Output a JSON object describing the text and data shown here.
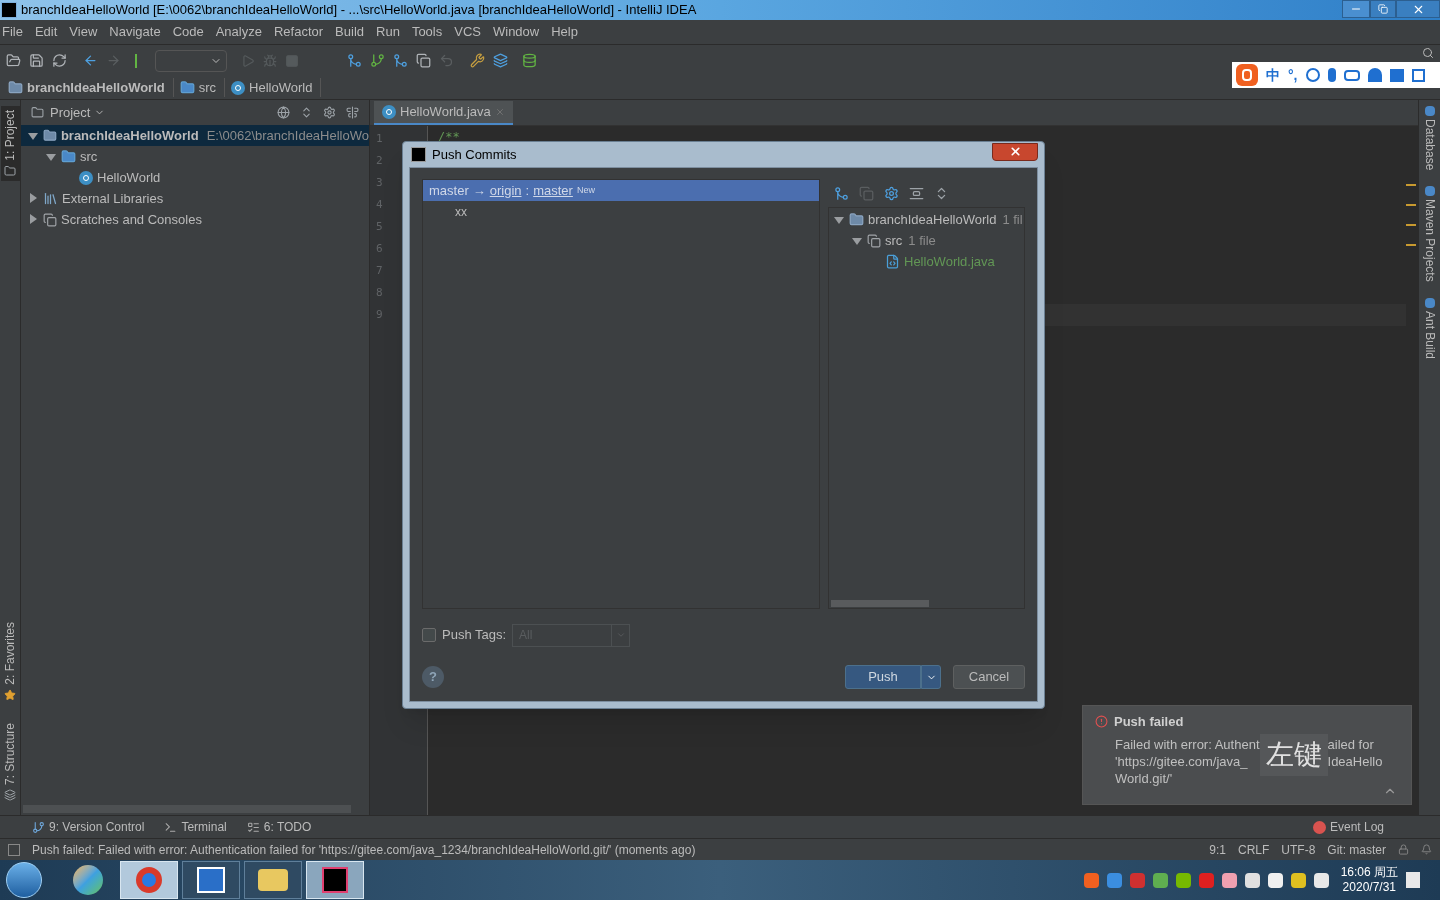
{
  "window": {
    "title": "branchIdeaHelloWorld [E:\\0062\\branchIdeaHelloWorld] - ...\\src\\HelloWorld.java [branchIdeaHelloWorld] - IntelliJ IDEA"
  },
  "menu": [
    "File",
    "Edit",
    "View",
    "Navigate",
    "Code",
    "Analyze",
    "Refactor",
    "Build",
    "Run",
    "Tools",
    "VCS",
    "Window",
    "Help"
  ],
  "ime": {
    "labels": [
      "中",
      "°,"
    ]
  },
  "breadcrumbs": [
    {
      "label": "branchIdeaHelloWorld",
      "kind": "project"
    },
    {
      "label": "src",
      "kind": "folder"
    },
    {
      "label": "HelloWorld",
      "kind": "class"
    }
  ],
  "left_stripe": [
    {
      "label": "1: Project",
      "selected": true,
      "kind": "project"
    },
    {
      "label": "2: Favorites",
      "selected": false,
      "kind": "favorites"
    },
    {
      "label": "7: Structure",
      "selected": false,
      "kind": "structure"
    }
  ],
  "project_panel": {
    "title": "Project",
    "tree": [
      {
        "label": "branchIdeaHelloWorld",
        "detail": "E:\\0062\\branchIdeaHelloWo",
        "kind": "project",
        "expanded": true,
        "selected": true,
        "children": [
          {
            "label": "src",
            "kind": "folder",
            "expanded": true,
            "selected": false,
            "children": [
              {
                "label": "HelloWorld",
                "kind": "class",
                "selected": false
              }
            ]
          }
        ]
      },
      {
        "label": "External Libraries",
        "kind": "libraries",
        "expanded": false,
        "selected": false
      },
      {
        "label": "Scratches and Consoles",
        "kind": "scratches",
        "expanded": false,
        "selected": false
      }
    ]
  },
  "editor": {
    "tabs": [
      {
        "label": "HelloWorld.java",
        "selected": true
      }
    ],
    "line_numbers": [
      "1",
      "2",
      "3",
      "4",
      "5",
      "6",
      "7",
      "8",
      "9"
    ],
    "code_lines": [
      "/**"
    ]
  },
  "right_stripe": [
    "Database",
    "Maven Projects",
    "Ant Build"
  ],
  "dialog": {
    "title": "Push Commits",
    "push_spec": {
      "source": "master",
      "arrow": "→",
      "remote": "origin",
      "separator": ":",
      "target": "master",
      "badge": "New",
      "selected": true
    },
    "commits": [
      "xx"
    ],
    "changes_tree": [
      {
        "label": "branchIdeaHelloWorld",
        "detail": "1 fil",
        "kind": "project",
        "expanded": true,
        "children": [
          {
            "label": "src",
            "detail": "1 file",
            "kind": "folder",
            "expanded": true,
            "children": [
              {
                "label": "HelloWorld.java",
                "kind": "added-file"
              }
            ]
          }
        ]
      }
    ],
    "push_tags": {
      "label": "Push Tags:",
      "checked": false,
      "value": "All",
      "disabled": true
    },
    "help": "?",
    "buttons": [
      {
        "label": "Push",
        "kind": "primary"
      },
      {
        "label": "Cancel",
        "kind": "secondary"
      }
    ]
  },
  "notification": {
    "title": "Push failed",
    "left_lines": [
      "Failed with error: Authent",
      "'https://gitee.com/java_",
      "World.git/'"
    ],
    "right_lines": [
      "ailed for",
      "IdeaHello"
    ],
    "overlay": "左键"
  },
  "tool_windows": [
    {
      "label": "9: Version Control",
      "kind": "vcs"
    },
    {
      "label": "Terminal",
      "kind": "terminal"
    },
    {
      "label": "6: TODO",
      "kind": "todo"
    }
  ],
  "event_log": {
    "label": "Event Log"
  },
  "status_bar": {
    "message": "Push failed: Failed with error: Authentication failed for 'https://gitee.com/java_1234/branchIdeaHelloWorld.git/' (moments ago)",
    "position": "9:1",
    "line_separator": "CRLF",
    "encoding": "UTF-8",
    "branch": "Git: master"
  },
  "taskbar": {
    "time": "16:06 周五",
    "date": "2020/7/31"
  }
}
